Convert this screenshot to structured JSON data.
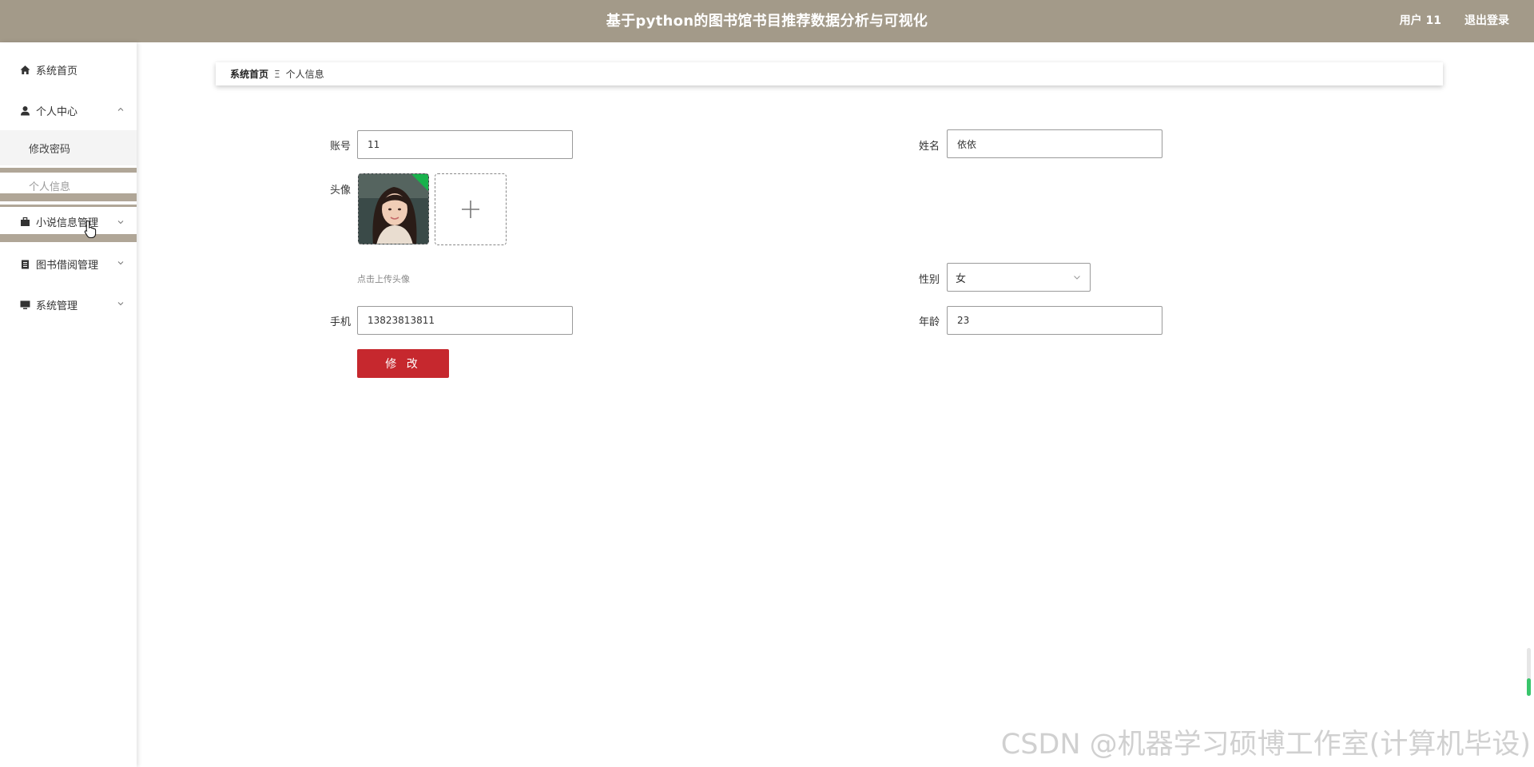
{
  "header": {
    "title": "基于python的图书馆书目推荐数据分析与可视化",
    "user": "用户 11",
    "logout": "退出登录"
  },
  "sidebar": {
    "items": [
      {
        "label": "系统首页",
        "icon": "home-icon"
      },
      {
        "label": "个人中心",
        "icon": "user-icon",
        "expanded": true,
        "children": [
          {
            "label": "修改密码"
          },
          {
            "label": "个人信息",
            "active": true
          }
        ]
      },
      {
        "label": "小说信息管理",
        "icon": "briefcase-icon"
      },
      {
        "label": "图书借阅管理",
        "icon": "clipboard-icon"
      },
      {
        "label": "系统管理",
        "icon": "monitor-icon"
      }
    ]
  },
  "breadcrumb": {
    "home": "系统首页",
    "separator": "Ξ",
    "current": "个人信息"
  },
  "form": {
    "account": {
      "label": "账号",
      "value": "11"
    },
    "name": {
      "label": "姓名",
      "value": "依依"
    },
    "avatar": {
      "label": "头像",
      "hint": "点击上传头像"
    },
    "gender": {
      "label": "性别",
      "value": "女"
    },
    "phone": {
      "label": "手机",
      "value": "13823813811"
    },
    "age": {
      "label": "年龄",
      "value": "23"
    },
    "submit": "修 改"
  },
  "watermark": "CSDN @机器学习硕博工作室(计算机毕设)",
  "colors": {
    "header_bg": "#a39a89",
    "submit_bg": "#c6282e",
    "accent_green": "#39c56b"
  }
}
